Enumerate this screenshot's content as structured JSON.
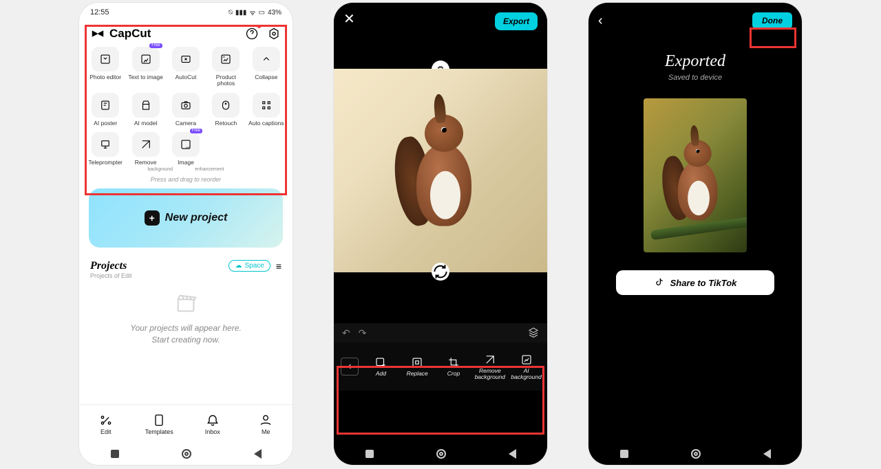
{
  "phone1": {
    "time": "12:55",
    "battery": "43%",
    "brand": "CapCut",
    "tools": [
      {
        "label": "Photo editor"
      },
      {
        "label": "Text to image",
        "badge": "Free"
      },
      {
        "label": "AutoCut"
      },
      {
        "label": "Product photos"
      },
      {
        "label": "Collapse"
      },
      {
        "label": "AI poster"
      },
      {
        "label": "AI model"
      },
      {
        "label": "Camera"
      },
      {
        "label": "Retouch"
      },
      {
        "label": "Auto captions"
      },
      {
        "label": "Teleprompter"
      },
      {
        "label": "Remove"
      },
      {
        "label": "Image",
        "badge": "Free"
      }
    ],
    "tool_sub1": "background",
    "tool_sub2": "enhancement",
    "reorder_hint": "Press and drag to reorder",
    "new_project": "New project",
    "projects_title": "Projects",
    "projects_sub": "Projects of Edit",
    "space_label": "Space",
    "empty1": "Your projects will appear here.",
    "empty2": "Start creating now.",
    "nav": [
      "Edit",
      "Templates",
      "Inbox",
      "Me"
    ]
  },
  "phone2": {
    "export": "Export",
    "tools": [
      "Add",
      "Replace",
      "Crop",
      "Remove background",
      "AI background"
    ]
  },
  "phone3": {
    "done": "Done",
    "title": "Exported",
    "subtitle": "Saved to device",
    "share": "Share to TikTok"
  }
}
